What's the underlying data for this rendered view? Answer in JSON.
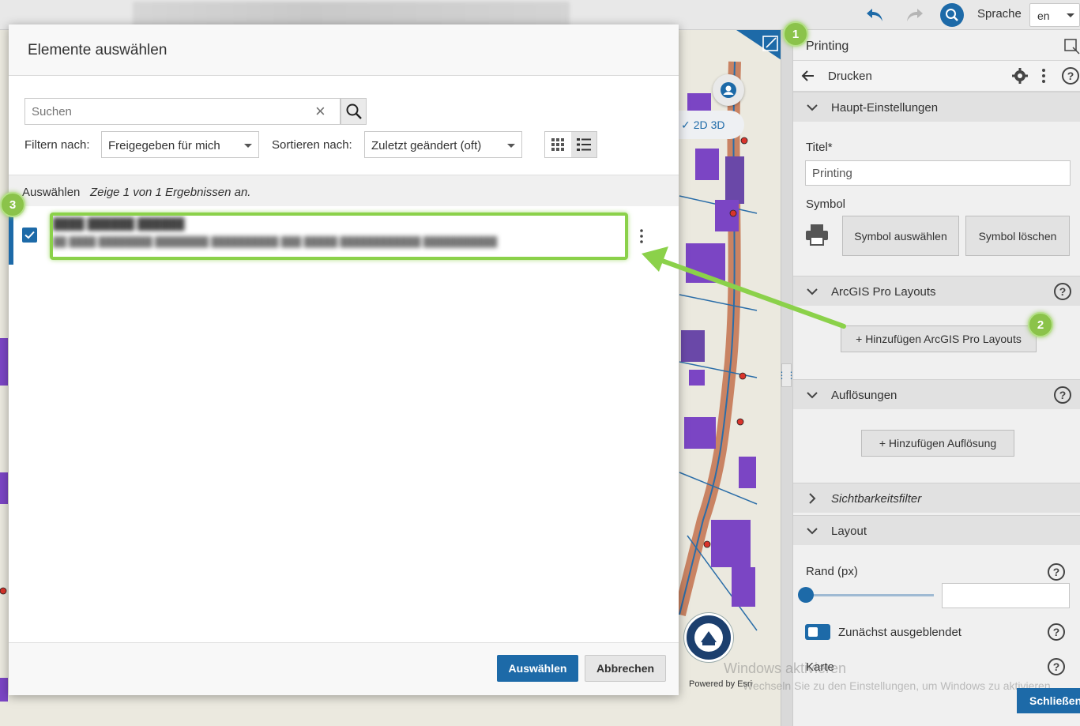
{
  "topbar": {
    "undo_icon": "undo-icon",
    "redo_icon": "redo-icon",
    "search_icon": "search-icon",
    "language_label": "Sprache",
    "language_value": "en"
  },
  "modal": {
    "title": "Elemente auswählen",
    "search": {
      "placeholder": "Suchen"
    },
    "filter": {
      "label": "Filtern nach:",
      "value": "Freigegeben für mich"
    },
    "sort": {
      "label": "Sortieren nach:",
      "value": "Zuletzt geändert (oft)"
    },
    "results": {
      "label": "Auswählen",
      "count_text": "Zeige 1 von 1 Ergebnissen an."
    },
    "select_button": "Auswählen",
    "cancel_button": "Abbrechen"
  },
  "map": {
    "toggle_2d": "2D",
    "toggle_3d": "3D",
    "powered_by": "Powered by Esri"
  },
  "panel": {
    "title": "Printing",
    "subheader": "Drucken",
    "main_settings": {
      "header": "Haupt-Einstellungen",
      "title_label": "Titel*",
      "title_value": "Printing",
      "symbol_label": "Symbol",
      "symbol_select": "Symbol auswählen",
      "symbol_delete": "Symbol löschen"
    },
    "layouts": {
      "header": "ArcGIS Pro Layouts",
      "add_button": "+ Hinzufügen ArcGIS Pro Layouts"
    },
    "resolutions": {
      "header": "Auflösungen",
      "add_button": "+ Hinzufügen Auflösung"
    },
    "visibility": {
      "header": "Sichtbarkeitsfilter"
    },
    "layout": {
      "header": "Layout",
      "margin_label": "Rand (px)",
      "margin_value": "",
      "margin_slider_fraction": 0,
      "hidden_label": "Zunächst ausgeblendet",
      "hidden_on": true,
      "map_label": "Karte"
    },
    "close_button": "Schließen"
  },
  "watermark": {
    "line1": "Windows aktivieren",
    "line2": "Wechseln Sie zu den Einstellungen, um Windows zu aktivieren."
  },
  "annotations": [
    "1",
    "2",
    "3"
  ],
  "colors": {
    "accent": "#1d6aa8",
    "annotation": "#8bc34a"
  }
}
